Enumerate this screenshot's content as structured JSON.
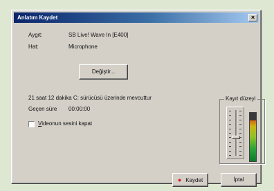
{
  "window": {
    "title": "Anlatım Kaydet",
    "close_glyph": "×"
  },
  "device": {
    "device_label": "Aygıt:",
    "device_value": "SB Live! Wave In [E400]",
    "input_label": "Hat:",
    "input_value": "Microphone",
    "change_button": "Değiştir..."
  },
  "status": {
    "free_space": "21 saat 12 dakika C: sürücüsü üzerinde mevcuttur",
    "elapsed_label": "Geçen süre",
    "elapsed_value": "00:00:00"
  },
  "mute_checkbox": {
    "label": "Videonun sesini kapat",
    "checked": false
  },
  "level": {
    "group_title": "Kayıt düzeyi",
    "slider_value": 0.4,
    "meter_level": 0.85
  },
  "buttons": {
    "record_icon": "record-dot-icon",
    "record_glyph": "●",
    "record_label": "Kaydet",
    "cancel_label": "İptal"
  }
}
